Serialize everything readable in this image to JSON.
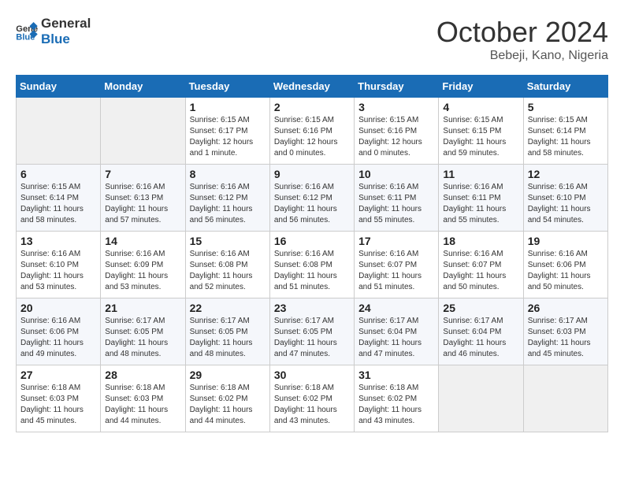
{
  "header": {
    "logo_line1": "General",
    "logo_line2": "Blue",
    "month": "October 2024",
    "location": "Bebeji, Kano, Nigeria"
  },
  "weekdays": [
    "Sunday",
    "Monday",
    "Tuesday",
    "Wednesday",
    "Thursday",
    "Friday",
    "Saturday"
  ],
  "weeks": [
    [
      {
        "day": "",
        "info": ""
      },
      {
        "day": "",
        "info": ""
      },
      {
        "day": "1",
        "info": "Sunrise: 6:15 AM\nSunset: 6:17 PM\nDaylight: 12 hours\nand 1 minute."
      },
      {
        "day": "2",
        "info": "Sunrise: 6:15 AM\nSunset: 6:16 PM\nDaylight: 12 hours\nand 0 minutes."
      },
      {
        "day": "3",
        "info": "Sunrise: 6:15 AM\nSunset: 6:16 PM\nDaylight: 12 hours\nand 0 minutes."
      },
      {
        "day": "4",
        "info": "Sunrise: 6:15 AM\nSunset: 6:15 PM\nDaylight: 11 hours\nand 59 minutes."
      },
      {
        "day": "5",
        "info": "Sunrise: 6:15 AM\nSunset: 6:14 PM\nDaylight: 11 hours\nand 58 minutes."
      }
    ],
    [
      {
        "day": "6",
        "info": "Sunrise: 6:15 AM\nSunset: 6:14 PM\nDaylight: 11 hours\nand 58 minutes."
      },
      {
        "day": "7",
        "info": "Sunrise: 6:16 AM\nSunset: 6:13 PM\nDaylight: 11 hours\nand 57 minutes."
      },
      {
        "day": "8",
        "info": "Sunrise: 6:16 AM\nSunset: 6:12 PM\nDaylight: 11 hours\nand 56 minutes."
      },
      {
        "day": "9",
        "info": "Sunrise: 6:16 AM\nSunset: 6:12 PM\nDaylight: 11 hours\nand 56 minutes."
      },
      {
        "day": "10",
        "info": "Sunrise: 6:16 AM\nSunset: 6:11 PM\nDaylight: 11 hours\nand 55 minutes."
      },
      {
        "day": "11",
        "info": "Sunrise: 6:16 AM\nSunset: 6:11 PM\nDaylight: 11 hours\nand 55 minutes."
      },
      {
        "day": "12",
        "info": "Sunrise: 6:16 AM\nSunset: 6:10 PM\nDaylight: 11 hours\nand 54 minutes."
      }
    ],
    [
      {
        "day": "13",
        "info": "Sunrise: 6:16 AM\nSunset: 6:10 PM\nDaylight: 11 hours\nand 53 minutes."
      },
      {
        "day": "14",
        "info": "Sunrise: 6:16 AM\nSunset: 6:09 PM\nDaylight: 11 hours\nand 53 minutes."
      },
      {
        "day": "15",
        "info": "Sunrise: 6:16 AM\nSunset: 6:08 PM\nDaylight: 11 hours\nand 52 minutes."
      },
      {
        "day": "16",
        "info": "Sunrise: 6:16 AM\nSunset: 6:08 PM\nDaylight: 11 hours\nand 51 minutes."
      },
      {
        "day": "17",
        "info": "Sunrise: 6:16 AM\nSunset: 6:07 PM\nDaylight: 11 hours\nand 51 minutes."
      },
      {
        "day": "18",
        "info": "Sunrise: 6:16 AM\nSunset: 6:07 PM\nDaylight: 11 hours\nand 50 minutes."
      },
      {
        "day": "19",
        "info": "Sunrise: 6:16 AM\nSunset: 6:06 PM\nDaylight: 11 hours\nand 50 minutes."
      }
    ],
    [
      {
        "day": "20",
        "info": "Sunrise: 6:16 AM\nSunset: 6:06 PM\nDaylight: 11 hours\nand 49 minutes."
      },
      {
        "day": "21",
        "info": "Sunrise: 6:17 AM\nSunset: 6:05 PM\nDaylight: 11 hours\nand 48 minutes."
      },
      {
        "day": "22",
        "info": "Sunrise: 6:17 AM\nSunset: 6:05 PM\nDaylight: 11 hours\nand 48 minutes."
      },
      {
        "day": "23",
        "info": "Sunrise: 6:17 AM\nSunset: 6:05 PM\nDaylight: 11 hours\nand 47 minutes."
      },
      {
        "day": "24",
        "info": "Sunrise: 6:17 AM\nSunset: 6:04 PM\nDaylight: 11 hours\nand 47 minutes."
      },
      {
        "day": "25",
        "info": "Sunrise: 6:17 AM\nSunset: 6:04 PM\nDaylight: 11 hours\nand 46 minutes."
      },
      {
        "day": "26",
        "info": "Sunrise: 6:17 AM\nSunset: 6:03 PM\nDaylight: 11 hours\nand 45 minutes."
      }
    ],
    [
      {
        "day": "27",
        "info": "Sunrise: 6:18 AM\nSunset: 6:03 PM\nDaylight: 11 hours\nand 45 minutes."
      },
      {
        "day": "28",
        "info": "Sunrise: 6:18 AM\nSunset: 6:03 PM\nDaylight: 11 hours\nand 44 minutes."
      },
      {
        "day": "29",
        "info": "Sunrise: 6:18 AM\nSunset: 6:02 PM\nDaylight: 11 hours\nand 44 minutes."
      },
      {
        "day": "30",
        "info": "Sunrise: 6:18 AM\nSunset: 6:02 PM\nDaylight: 11 hours\nand 43 minutes."
      },
      {
        "day": "31",
        "info": "Sunrise: 6:18 AM\nSunset: 6:02 PM\nDaylight: 11 hours\nand 43 minutes."
      },
      {
        "day": "",
        "info": ""
      },
      {
        "day": "",
        "info": ""
      }
    ]
  ]
}
